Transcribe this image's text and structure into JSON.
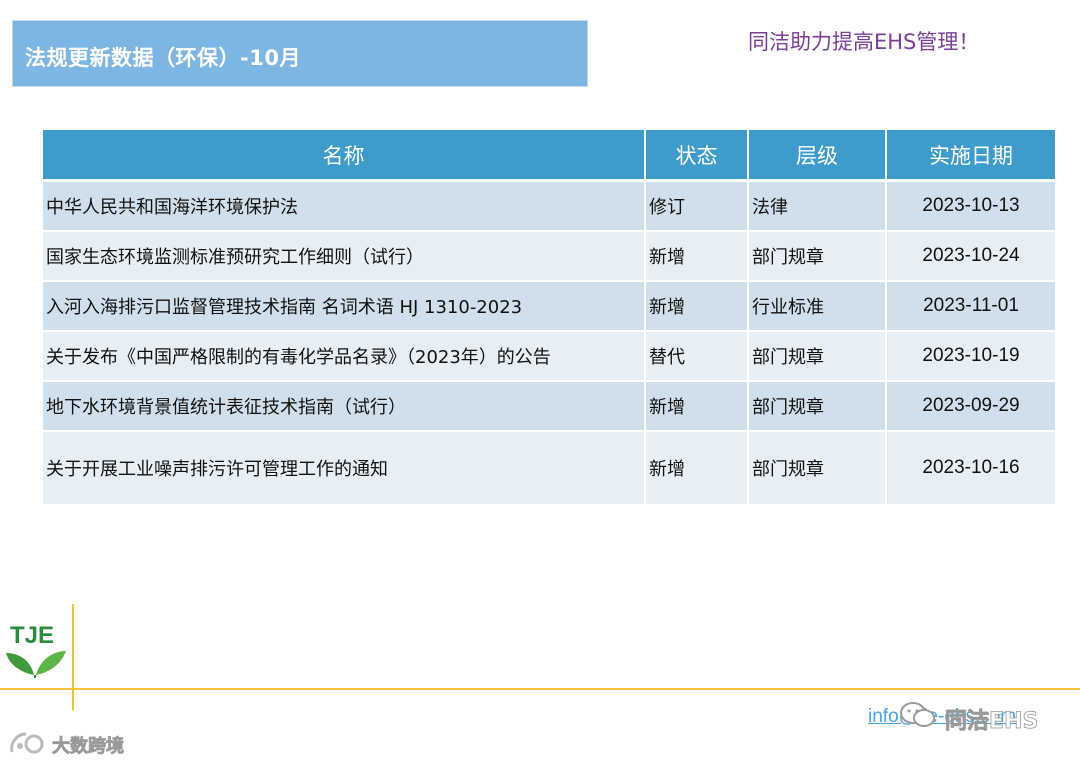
{
  "header": {
    "title": "法规更新数据（环保）-10月",
    "slogan": "同洁助力提高EHS管理！"
  },
  "table": {
    "columns": [
      "名称",
      "状态",
      "层级",
      "实施日期"
    ],
    "rows": [
      {
        "name": "中华人民共和国海洋环境保护法",
        "status": "修订",
        "level": "法律",
        "date": "2023-10-13"
      },
      {
        "name": "国家生态环境监测标准预研究工作细则（试行）",
        "status": "新增",
        "level": "部门规章",
        "date": "2023-10-24"
      },
      {
        "name": "入河入海排污口监督管理技术指南 名词术语 HJ 1310-2023",
        "status": "新增",
        "level": "行业标准",
        "date": "2023-11-01"
      },
      {
        "name": "关于发布《中国严格限制的有毒化学品名录》（2023年）的公告",
        "status": "替代",
        "level": "部门规章",
        "date": "2023-10-19"
      },
      {
        "name": "地下水环境背景值统计表征技术指南（试行）",
        "status": "新增",
        "level": "部门规章",
        "date": "2023-09-29"
      },
      {
        "name": "关于开展工业噪声排污许可管理工作的通知",
        "status": "新增",
        "level": "部门规章",
        "date": "2023-10-16"
      }
    ]
  },
  "footer": {
    "logo_text": "TJE",
    "contact_link": "info@tje-ehs.com",
    "watermark_text": "同洁EHS",
    "watermark2_text": "大数跨境"
  },
  "colors": {
    "title_bar": "#7eb6e3",
    "header_row": "#3d9ccb",
    "row_odd": "#cfe0ec",
    "row_even": "#e7eef4",
    "slogan": "#7a3f9c",
    "divider": "#f1c232",
    "logo_green": "#2b8a3e"
  },
  "icons": [
    "leaf-logo-icon",
    "wechat-icon",
    "watermark-logo-icon"
  ]
}
